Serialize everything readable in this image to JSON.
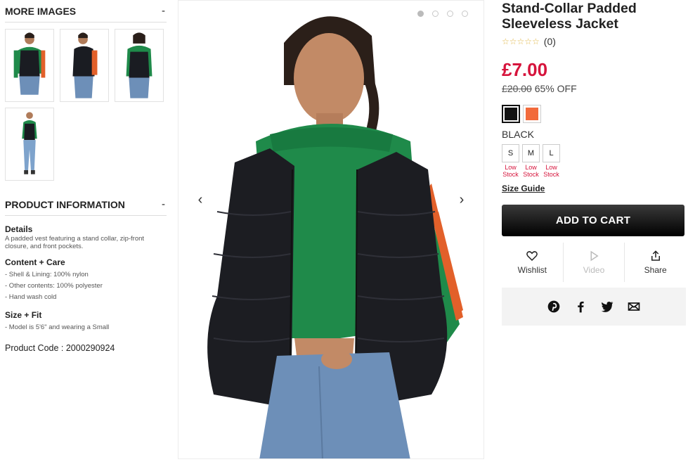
{
  "more_images": {
    "heading": "MORE IMAGES",
    "toggle": "-"
  },
  "product_info": {
    "heading": "PRODUCT INFORMATION",
    "toggle": "-",
    "details_title": "Details",
    "details_text": "A padded vest featuring a stand collar, zip-front closure, and front pockets.",
    "content_title": "Content + Care",
    "content_lines": [
      "- Shell & Lining: 100% nylon",
      "- Other contents: 100% polyester",
      "- Hand wash cold"
    ],
    "size_title": "Size + Fit",
    "size_lines": [
      "- Model is 5'6\" and wearing a Small"
    ],
    "product_code": "Product Code : 2000290924"
  },
  "gallery": {
    "prev_arrow": "‹",
    "next_arrow": "›",
    "dots": 4,
    "active_dot": 0
  },
  "product": {
    "title": "Stand-Collar Padded Sleeveless Jacket",
    "stars": "☆☆☆☆☆",
    "review_count": "(0)",
    "price": "£7.00",
    "was_price": "£20.00",
    "discount": "65% OFF",
    "colors": [
      {
        "name": "black",
        "hex": "#111111"
      },
      {
        "name": "orange",
        "hex": "#f26a3b"
      }
    ],
    "selected_color_label": "BLACK",
    "sizes": [
      {
        "label": "S",
        "stock": "Low Stock"
      },
      {
        "label": "M",
        "stock": "Low Stock"
      },
      {
        "label": "L",
        "stock": "Low Stock"
      }
    ],
    "size_guide": "Size Guide",
    "add_to_cart": "ADD TO CART",
    "actions": {
      "wishlist": "Wishlist",
      "video": "Video",
      "share": "Share"
    },
    "share_icons": [
      "pinterest-icon",
      "facebook-icon",
      "twitter-icon",
      "email-icon"
    ],
    "accent_color": "#d6143c"
  }
}
